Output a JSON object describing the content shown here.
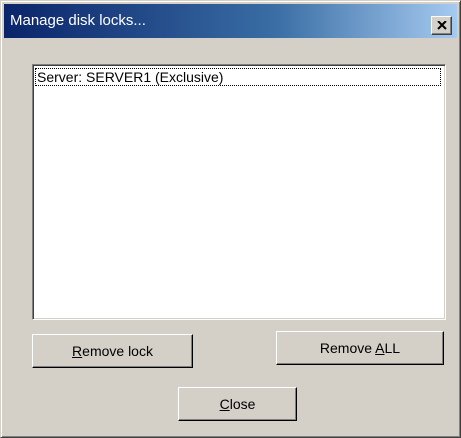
{
  "window": {
    "title": "Manage disk locks..."
  },
  "list": {
    "items": [
      {
        "label": "Server: SERVER1 (Exclusive)"
      }
    ]
  },
  "buttons": {
    "remove_lock": {
      "mnemonic": "R",
      "rest": "emove lock"
    },
    "remove_all": {
      "prefix": "Remove ",
      "mnemonic": "A",
      "rest": "LL"
    },
    "close": {
      "mnemonic": "C",
      "rest": "lose"
    }
  },
  "icons": {
    "close": "close-icon"
  },
  "colors": {
    "titlebar_start": "#0a246a",
    "titlebar_end": "#a6caf0",
    "face": "#d4d0c8"
  }
}
